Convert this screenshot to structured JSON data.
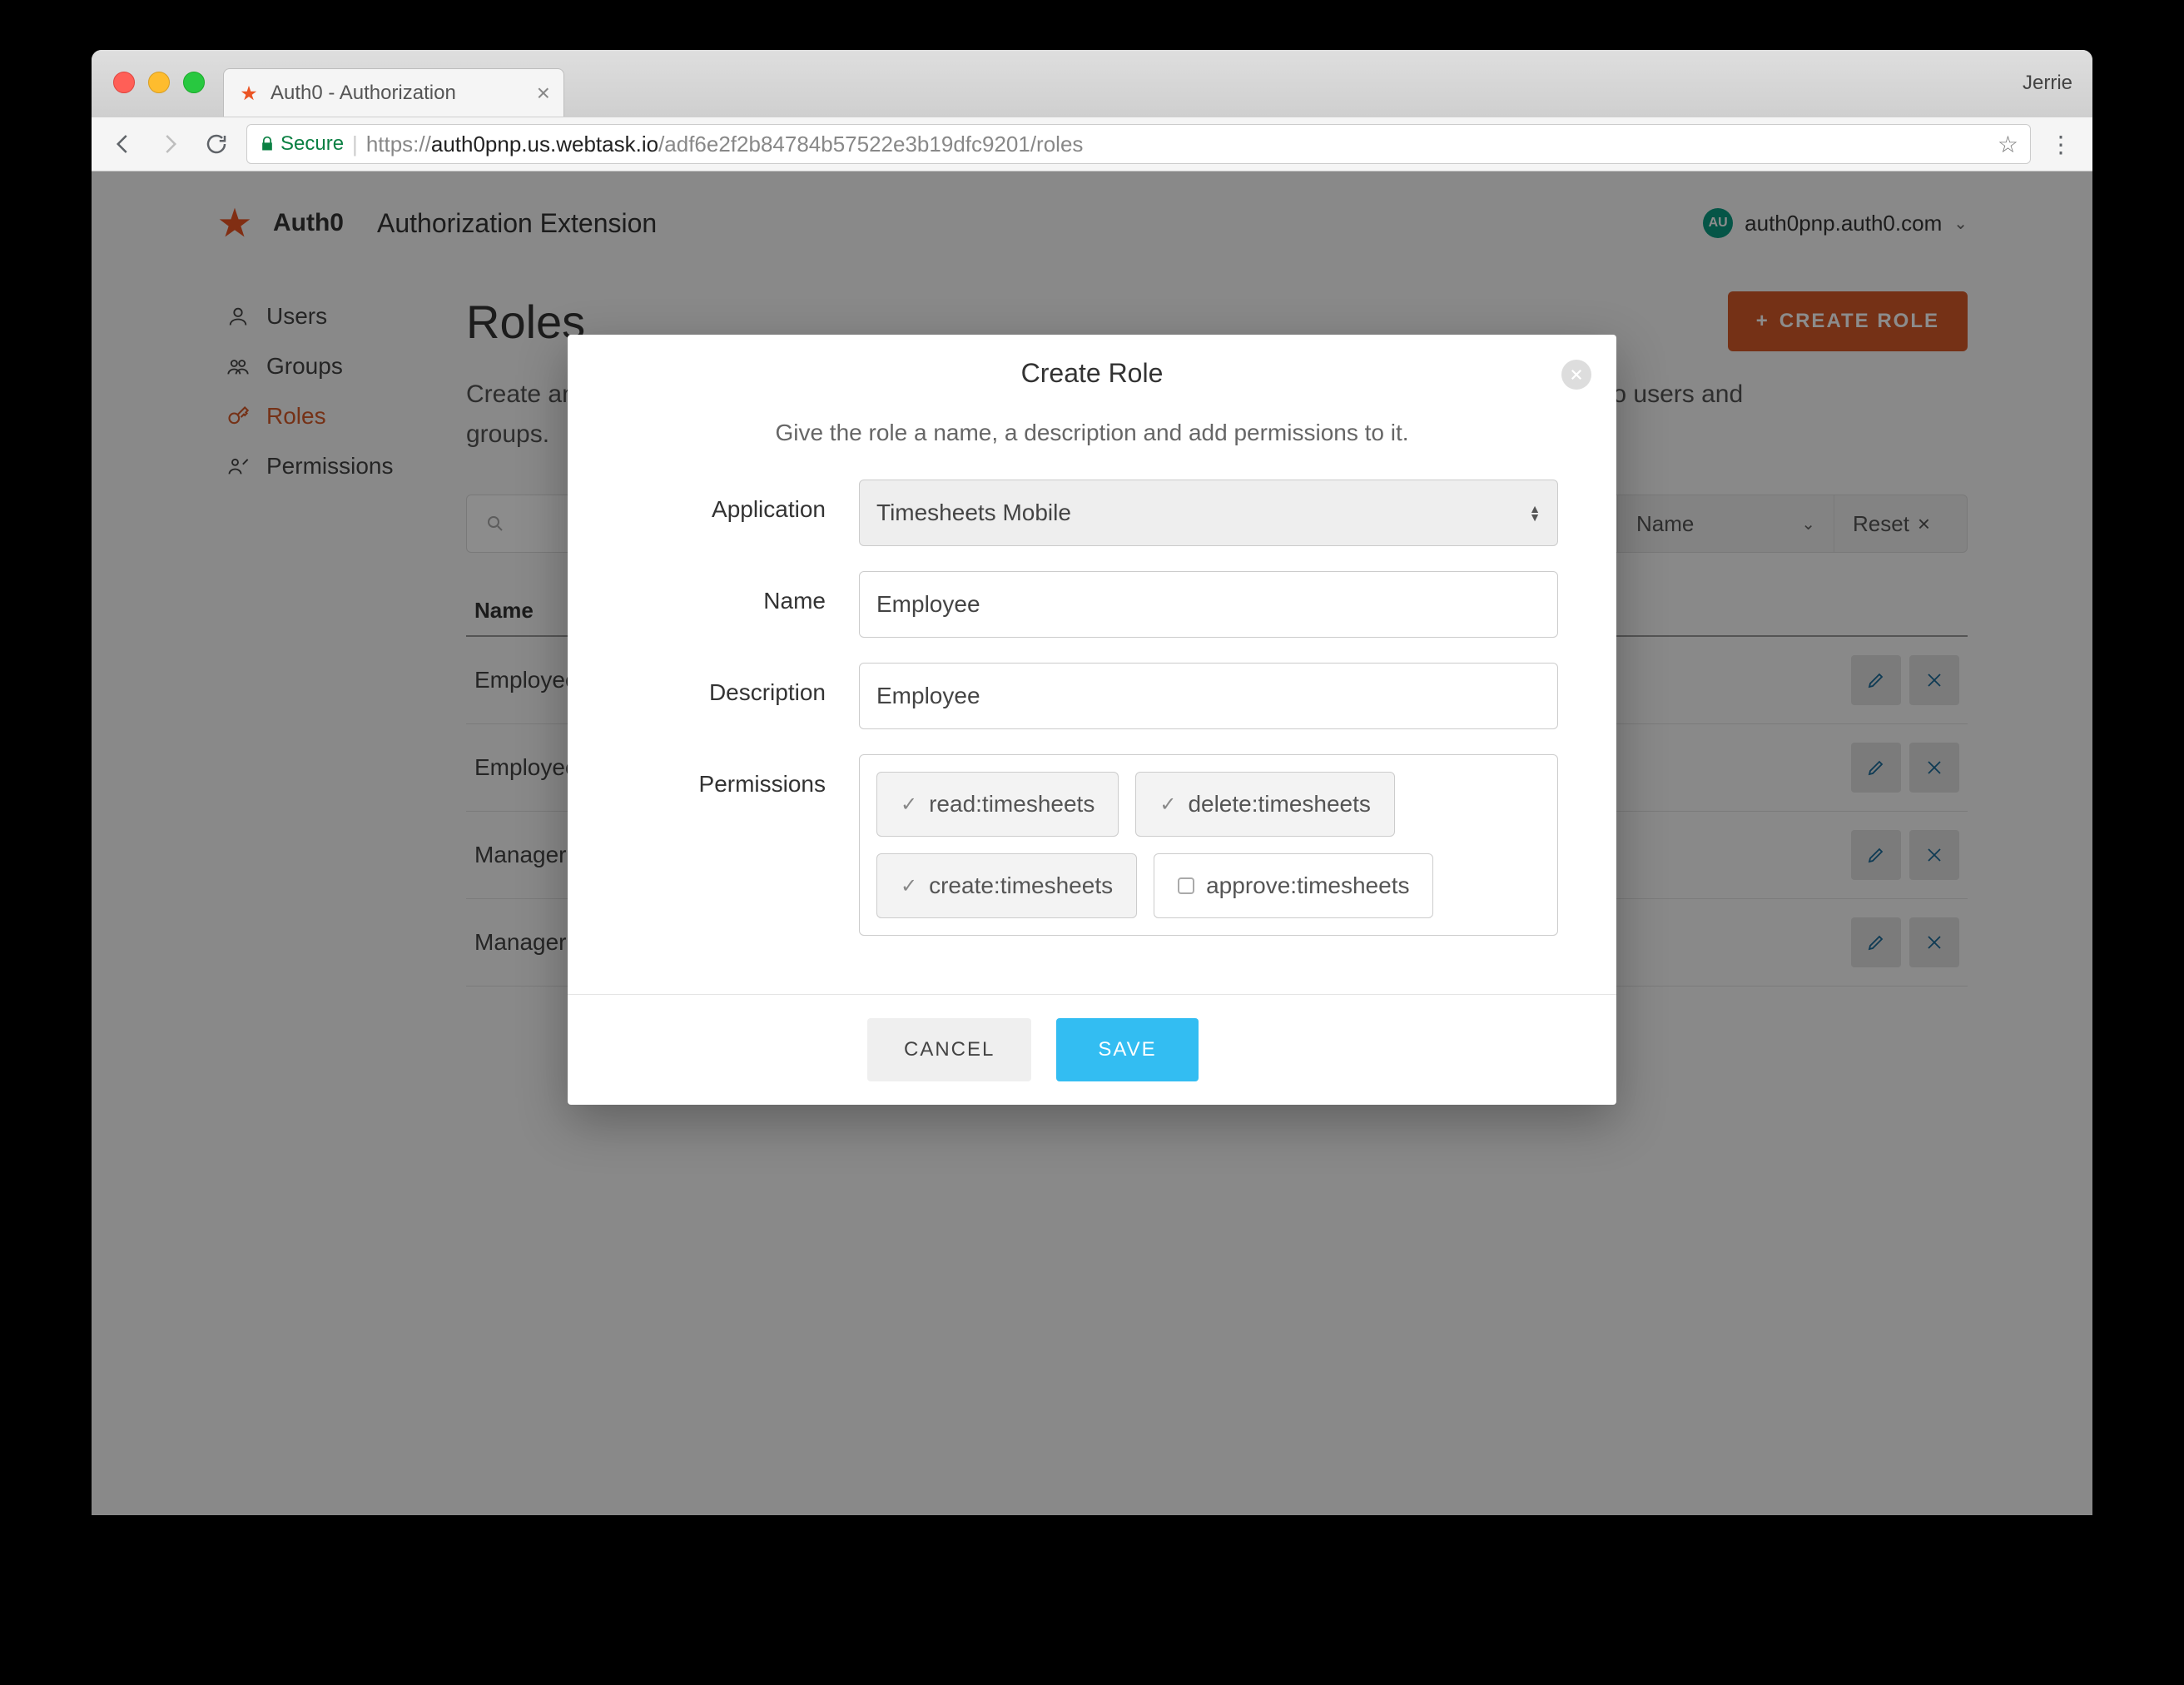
{
  "browser": {
    "profile_name": "Jerrie",
    "tab_title": "Auth0 - Authorization",
    "secure_label": "Secure",
    "url_proto": "https://",
    "url_host": "auth0pnp.us.webtask.io",
    "url_path": "/adf6e2f2b84784b57522e3b19dfc9201/roles"
  },
  "header": {
    "brand": "Auth0",
    "ext_title": "Authorization Extension",
    "account": "auth0pnp.auth0.com",
    "avatar_initials": "AU"
  },
  "sidebar": {
    "items": [
      {
        "label": "Users"
      },
      {
        "label": "Groups"
      },
      {
        "label": "Roles"
      },
      {
        "label": "Permissions"
      }
    ]
  },
  "main": {
    "page_title": "Roles",
    "create_button": "CREATE ROLE",
    "description": "Create and manage Roles (collection of permissions) for your applications which can then be assigned to users and groups.",
    "search_placeholder": "Search",
    "sort_label": "Name",
    "reset_label": "Reset",
    "table_header": "Name",
    "rows": [
      "Employee",
      "Employee",
      "Manager",
      "Manager"
    ]
  },
  "modal": {
    "title": "Create Role",
    "subtitle": "Give the role a name, a description and add permissions to it.",
    "labels": {
      "application": "Application",
      "name": "Name",
      "description": "Description",
      "permissions": "Permissions"
    },
    "application_value": "Timesheets Mobile",
    "name_value": "Employee",
    "description_value": "Employee",
    "permissions": [
      {
        "label": "read:timesheets",
        "selected": true
      },
      {
        "label": "delete:timesheets",
        "selected": true
      },
      {
        "label": "create:timesheets",
        "selected": true
      },
      {
        "label": "approve:timesheets",
        "selected": false
      }
    ],
    "cancel": "CANCEL",
    "save": "SAVE"
  }
}
